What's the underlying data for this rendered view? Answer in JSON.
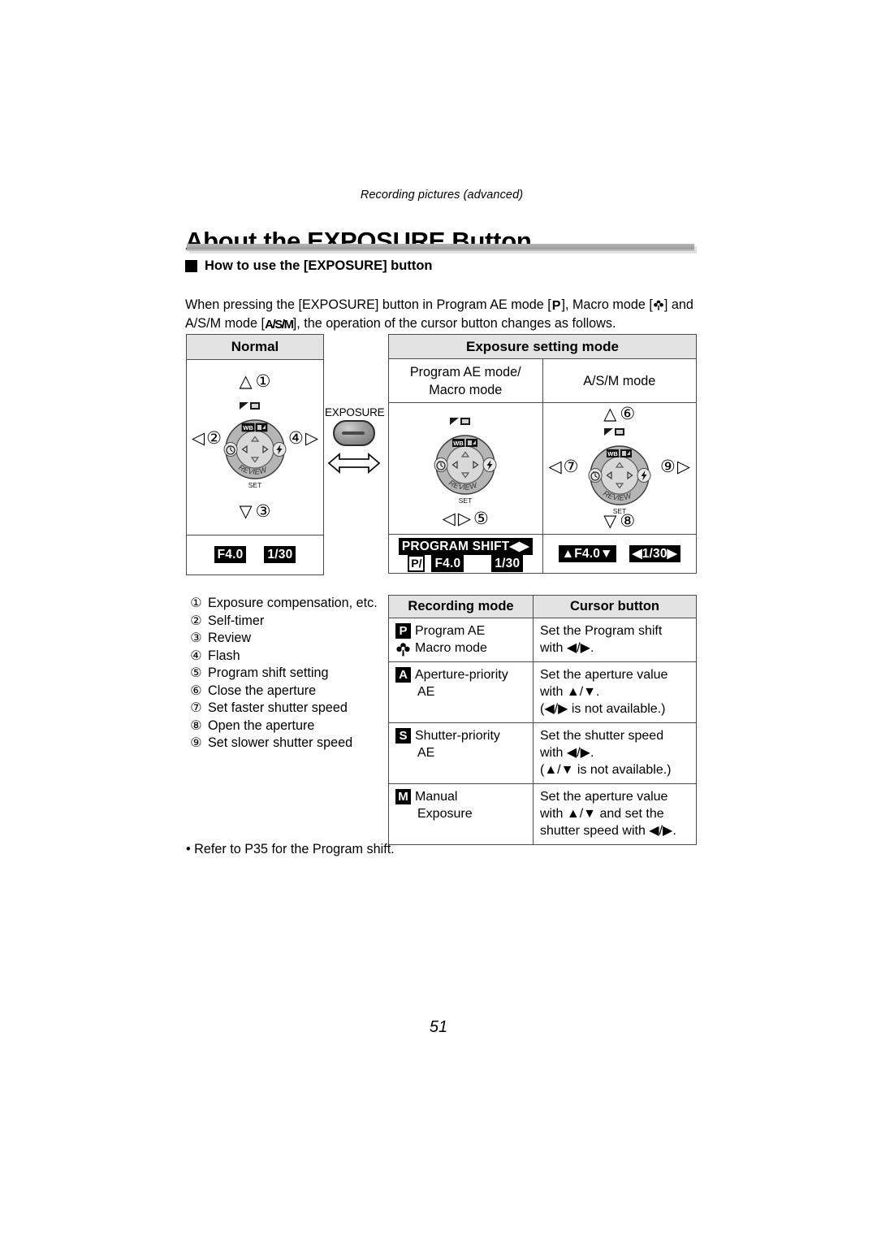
{
  "running_head": "Recording pictures (advanced)",
  "title": "About the EXPOSURE Button",
  "subhead": "How to use the [EXPOSURE] button",
  "intro": {
    "part1": "When pressing the [EXPOSURE] button in Program AE mode [",
    "chip_p": "P",
    "part2": "], Macro mode [",
    "chip_macro": "macro-flower-icon",
    "part3": "] and A/S/M mode [",
    "chip_asm": "A/S/M",
    "part4": "], the operation of the cursor button changes as follows."
  },
  "normal_panel": {
    "header": "Normal",
    "arrow_up": "△",
    "arrow_down": "▽",
    "arrow_left": "◁",
    "arrow_right": "▷",
    "num_up": "①",
    "num_left": "②",
    "num_down": "③",
    "num_right": "④",
    "display": {
      "aperture": "F4.0",
      "shutter": "1/30"
    }
  },
  "exposure_button": {
    "label": "EXPOSURE",
    "icon": "double-arrow-icon"
  },
  "exposure_setting_table": {
    "header": "Exposure setting mode",
    "col1_title_line1": "Program AE mode/",
    "col1_title_line2": "Macro mode",
    "col2_title": "A/S/M mode",
    "program_ae": {
      "arrow_left": "◁",
      "arrow_right": "▷",
      "num": "⑤",
      "display_banner": "PROGRAM SHIFT",
      "display_banner_arrows": "◀▶",
      "display_mode_chip": "P/",
      "display_aperture": "F4.0",
      "display_shutter": "1/30"
    },
    "asm": {
      "arrow_up": "△",
      "arrow_down": "▽",
      "arrow_left": "◁",
      "arrow_right": "▷",
      "num_up": "⑥",
      "num_left": "⑦",
      "num_down": "⑧",
      "num_right": "⑨",
      "display_aperture": "▲F4.0▼",
      "display_shutter": "◀1/30▶"
    }
  },
  "legend": [
    {
      "num": "①",
      "text": "Exposure compensation, etc."
    },
    {
      "num": "②",
      "text": "Self-timer"
    },
    {
      "num": "③",
      "text": "Review"
    },
    {
      "num": "④",
      "text": "Flash"
    },
    {
      "num": "⑤",
      "text": "Program shift setting"
    },
    {
      "num": "⑥",
      "text": "Close the aperture"
    },
    {
      "num": "⑦",
      "text": "Set faster shutter speed"
    },
    {
      "num": "⑧",
      "text": "Open the aperture"
    },
    {
      "num": "⑨",
      "text": "Set slower shutter speed"
    }
  ],
  "recording_mode_table": {
    "header_mode": "Recording mode",
    "header_cursor": "Cursor button",
    "rows": [
      {
        "badge1": "P",
        "mode_line1": "Program AE",
        "badge2": "macro-flower-icon",
        "mode_line2": "Macro mode",
        "cursor_line1": "Set the Program shift",
        "cursor_line2": "with ◀/▶.",
        "cursor_line3": ""
      },
      {
        "badge1": "A",
        "mode_line1": "Aperture-priority",
        "mode_line2": "AE",
        "cursor_line1": "Set the aperture value",
        "cursor_line2": "with ▲/▼.",
        "cursor_line3": "(◀/▶ is not available.)"
      },
      {
        "badge1": "S",
        "mode_line1": "Shutter-priority",
        "mode_line2": "AE",
        "cursor_line1": "Set the shutter speed",
        "cursor_line2": "with ◀/▶.",
        "cursor_line3": "(▲/▼ is not available.)"
      },
      {
        "badge1": "M",
        "mode_line1": "Manual",
        "mode_line2": "Exposure",
        "cursor_line1": "Set the aperture value",
        "cursor_line2": "with ▲/▼ and set the",
        "cursor_line3": "shutter speed with ◀/▶."
      }
    ]
  },
  "footnote": "• Refer to P35 for the Program shift.",
  "page_number": "51",
  "wheel": {
    "review_label": "REVIEW",
    "set_label": "SET",
    "icon_top_left": "exposure-compensation-icon",
    "icon_top_right": "burst-icon",
    "icon_wb": "WB",
    "icon_iso": "iso-icon",
    "icon_left": "self-timer-icon",
    "icon_right": "flash-icon"
  },
  "colors": {
    "border": "#4b4b4b",
    "header_fill": "#e3e3e3",
    "wheel_ring": "#b5b5b5",
    "wheel_inner": "#d8d8d8",
    "lcd_bg": "#000000"
  }
}
